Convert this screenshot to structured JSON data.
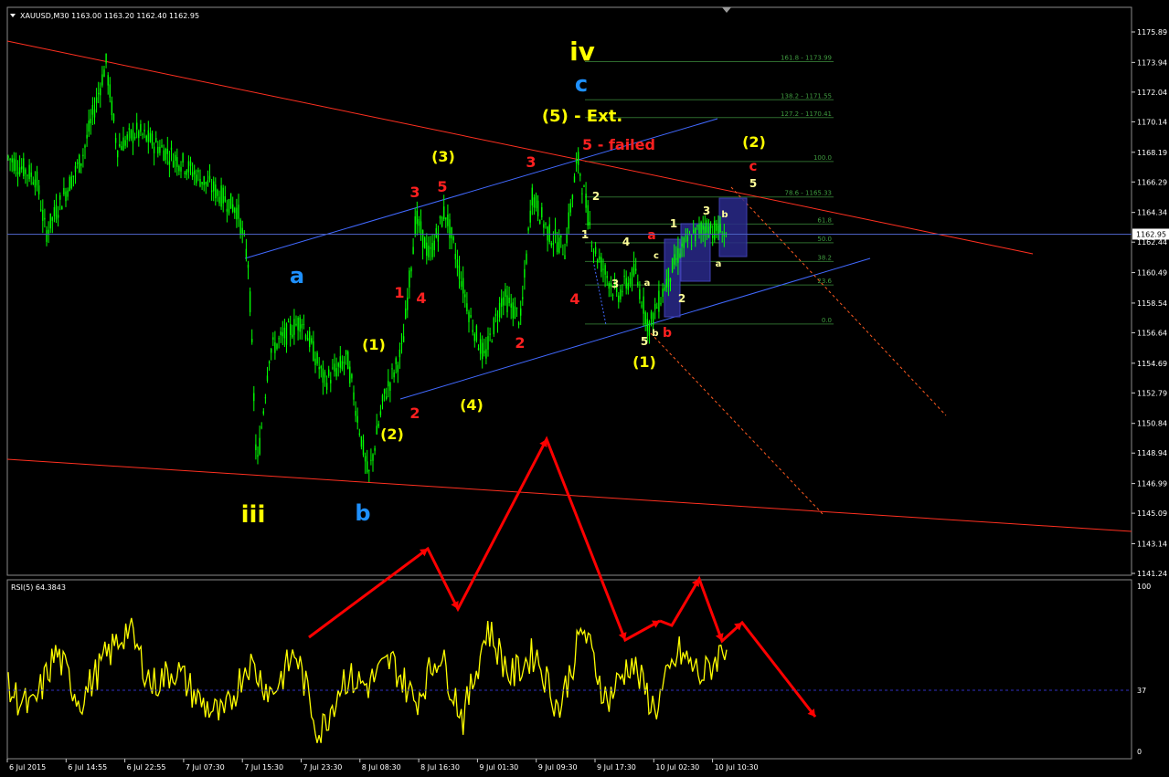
{
  "header": {
    "symbol_info": "XAUUSD,M30  1163.00 1163.20 1162.40 1162.95",
    "rsi_info": "RSI(5) 64.3843"
  },
  "price_axis": {
    "ticks": [
      "1175.89",
      "1173.94",
      "1172.04",
      "1170.14",
      "1168.19",
      "1166.29",
      "1164.34",
      "1162.44",
      "1160.49",
      "1158.54",
      "1156.64",
      "1154.69",
      "1152.79",
      "1150.84",
      "1148.94",
      "1146.99",
      "1145.09",
      "1143.14",
      "1141.24"
    ],
    "current_price": "1162.95"
  },
  "rsi_axis": {
    "ticks": [
      "100",
      "37",
      "0"
    ],
    "level": 37
  },
  "time_axis": {
    "labels": [
      "6 Jul 2015",
      "6 Jul 14:55",
      "6 Jul 22:55",
      "7 Jul 07:30",
      "7 Jul 15:30",
      "7 Jul 23:30",
      "8 Jul 08:30",
      "8 Jul 16:30",
      "9 Jul 01:30",
      "9 Jul 09:30",
      "9 Jul 17:30",
      "10 Jul 02:30",
      "10 Jul 10:30"
    ]
  },
  "fibonacci": {
    "levels": [
      {
        "label": "161.8 - 1173.99",
        "price": 1173.99
      },
      {
        "label": "138.2 - 1171.55",
        "price": 1171.55
      },
      {
        "label": "127.2 - 1170.41",
        "price": 1170.41
      },
      {
        "label": "100.0",
        "price": 1167.6
      },
      {
        "label": "78.6 - 1165.33",
        "price": 1165.33
      },
      {
        "label": "61.8",
        "price": 1163.6
      },
      {
        "label": "50.0",
        "price": 1162.4
      },
      {
        "label": "38.2",
        "price": 1161.2
      },
      {
        "label": "23.6",
        "price": 1159.7
      },
      {
        "label": "0.0",
        "price": 1157.2
      }
    ]
  },
  "wave_labels": [
    {
      "text": "iv",
      "color": "#ffff00",
      "size": 28
    },
    {
      "text": "c",
      "color": "#1e90ff",
      "size": 24
    },
    {
      "text": "(5) - Ext.",
      "color": "#ffff00",
      "size": 18
    },
    {
      "text": "5 - failed",
      "color": "#ff2020",
      "size": 16
    },
    {
      "text": "(3)",
      "color": "#ffff00",
      "size": 16
    },
    {
      "text": "3",
      "color": "#ff2020",
      "size": 16
    },
    {
      "text": "5",
      "color": "#ff2020",
      "size": 16
    },
    {
      "text": "3",
      "color": "#ff2020",
      "size": 16
    },
    {
      "text": "a",
      "color": "#1e90ff",
      "size": 24
    },
    {
      "text": "1",
      "color": "#ff2020",
      "size": 16
    },
    {
      "text": "4",
      "color": "#ff2020",
      "size": 16
    },
    {
      "text": "(1)",
      "color": "#ffff00",
      "size": 16
    },
    {
      "text": "2",
      "color": "#ff2020",
      "size": 16
    },
    {
      "text": "4",
      "color": "#ff2020",
      "size": 16
    },
    {
      "text": "(4)",
      "color": "#ffff00",
      "size": 16
    },
    {
      "text": "2",
      "color": "#ff2020",
      "size": 16
    },
    {
      "text": "(2)",
      "color": "#ffff00",
      "size": 16
    },
    {
      "text": "iii",
      "color": "#ffff00",
      "size": 26
    },
    {
      "text": "b",
      "color": "#1e90ff",
      "size": 24
    },
    {
      "text": "(2)",
      "color": "#ffff00",
      "size": 16
    },
    {
      "text": "c",
      "color": "#ff2020",
      "size": 15
    },
    {
      "text": "5",
      "color": "#ffff99",
      "size": 12
    },
    {
      "text": "a",
      "color": "#ff2020",
      "size": 14
    },
    {
      "text": "b",
      "color": "#ff2020",
      "size": 14
    },
    {
      "text": "(1)",
      "color": "#ffff00",
      "size": 16
    },
    {
      "text": "5",
      "color": "#ffff99",
      "size": 12
    },
    {
      "text": "3",
      "color": "#ffff99",
      "size": 12
    },
    {
      "text": "2",
      "color": "#ffff99",
      "size": 12
    },
    {
      "text": "1",
      "color": "#ffff99",
      "size": 12
    },
    {
      "text": "4",
      "color": "#ffff99",
      "size": 12
    },
    {
      "text": "2",
      "color": "#ffff99",
      "size": 12
    },
    {
      "text": "1",
      "color": "#ffff99",
      "size": 12
    },
    {
      "text": "3",
      "color": "#ffff99",
      "size": 12
    },
    {
      "text": "b",
      "color": "#ffff99",
      "size": 10
    },
    {
      "text": "a",
      "color": "#ffff99",
      "size": 10
    },
    {
      "text": "c",
      "color": "#ffff99",
      "size": 10
    },
    {
      "text": "a",
      "color": "#ffff99",
      "size": 10
    },
    {
      "text": "b",
      "color": "#ffff99",
      "size": 10
    }
  ],
  "colors": {
    "background": "#000000",
    "candles": "#00ff00",
    "rsi_line": "#ffff00",
    "trendline_red": "#ff3020",
    "channel_blue": "#4169ff",
    "fib_lines": "#2e6b2e",
    "arrows": "#ff0000",
    "box": "#2a2a8a"
  },
  "chart_data": {
    "type": "line",
    "price_series_note": "",
    "close_path_x": [
      "6 Jul 2015",
      "6 Jul 14:55",
      "6 Jul 22:55",
      "7 Jul 07:30",
      "7 Jul 15:30",
      "7 Jul 23:30",
      "8 Jul 08:30",
      "8 Jul 16:30",
      "9 Jul 01:30",
      "9 Jul 09:30",
      "9 Jul 17:30",
      "10 Jul 02:30",
      "10 Jul 10:30"
    ],
    "close_path_y": [
      1167.9,
      1172.0,
      1169.0,
      1168.0,
      1154.0,
      1153.5,
      1148.0,
      1163.0,
      1158.0,
      1164.0,
      1159.0,
      1160.0,
      1162.95
    ],
    "rsi_values": [
      37,
      25,
      60,
      30,
      55,
      75,
      40,
      50,
      30,
      20,
      55,
      35,
      60,
      10,
      45,
      40,
      55,
      30,
      60,
      20,
      75,
      45,
      60,
      25,
      75,
      30,
      55,
      25,
      60,
      45,
      65
    ],
    "ylim_price": [
      1141.24,
      1175.89
    ],
    "ylim_rsi": [
      0,
      100
    ],
    "current_price": 1162.95
  }
}
